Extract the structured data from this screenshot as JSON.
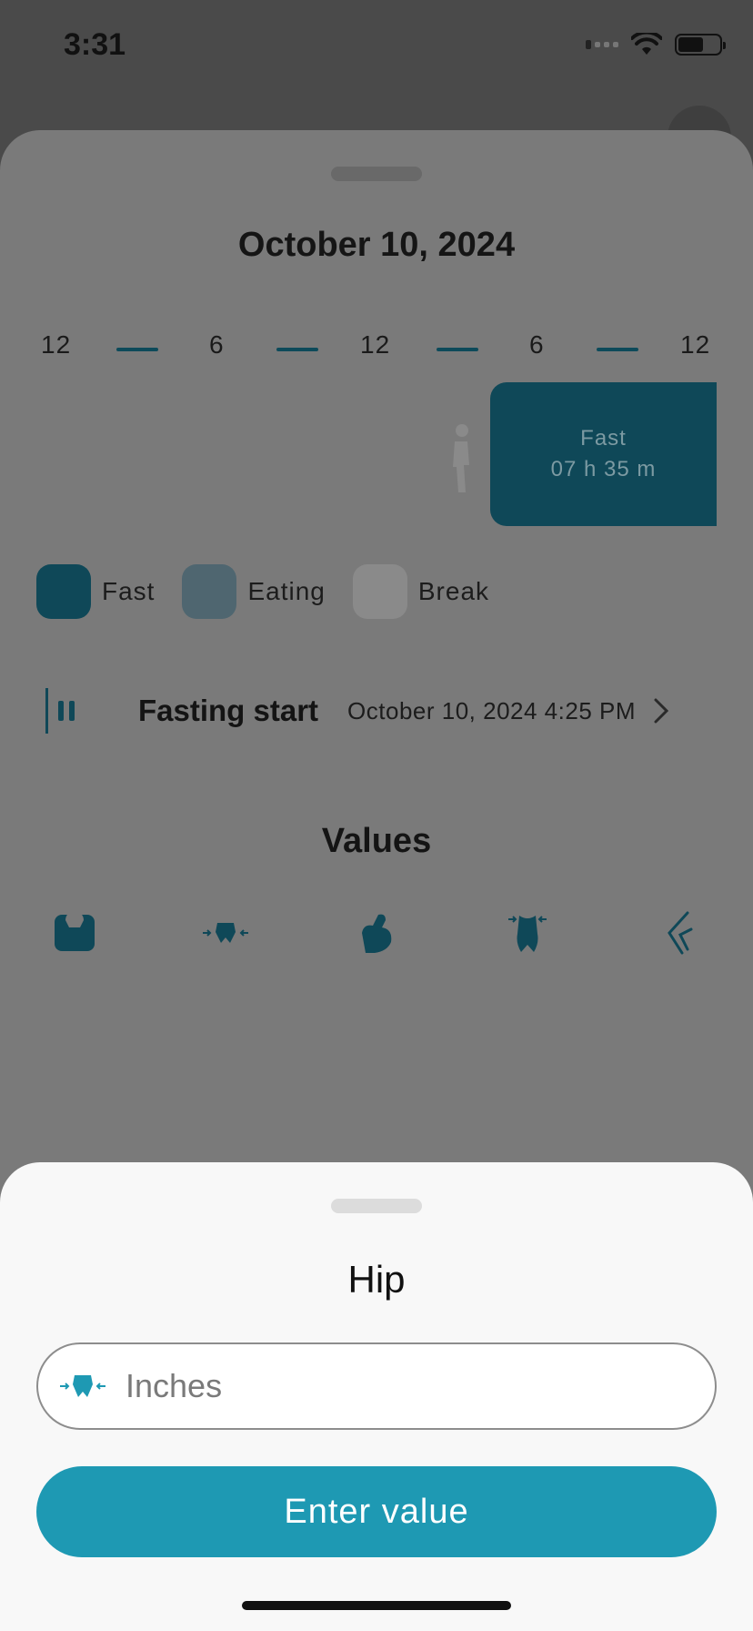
{
  "status_bar": {
    "time": "3:31"
  },
  "main": {
    "date_title": "October 10, 2024",
    "timeline": {
      "labels": [
        "12",
        "6",
        "12",
        "6",
        "12"
      ],
      "fast_block": {
        "title": "Fast",
        "duration": "07 h 35 m"
      }
    },
    "legend": [
      {
        "label": "Fast",
        "color": "#0f4858"
      },
      {
        "label": "Eating",
        "color": "#4f6670"
      },
      {
        "label": "Break",
        "color": "#8a8a8a"
      }
    ],
    "fasting_start": {
      "label": "Fasting start",
      "value": "October 10, 2024 4:25 PM"
    },
    "values_title": "Values",
    "value_icons": [
      "scale-icon",
      "hip-icon",
      "arm-icon",
      "waist-icon",
      "thigh-icon"
    ]
  },
  "sheet": {
    "title": "Hip",
    "input_placeholder": "Inches",
    "button_label": "Enter value"
  },
  "colors": {
    "accent": "#1e99b3",
    "dark_teal": "#0f4858"
  }
}
